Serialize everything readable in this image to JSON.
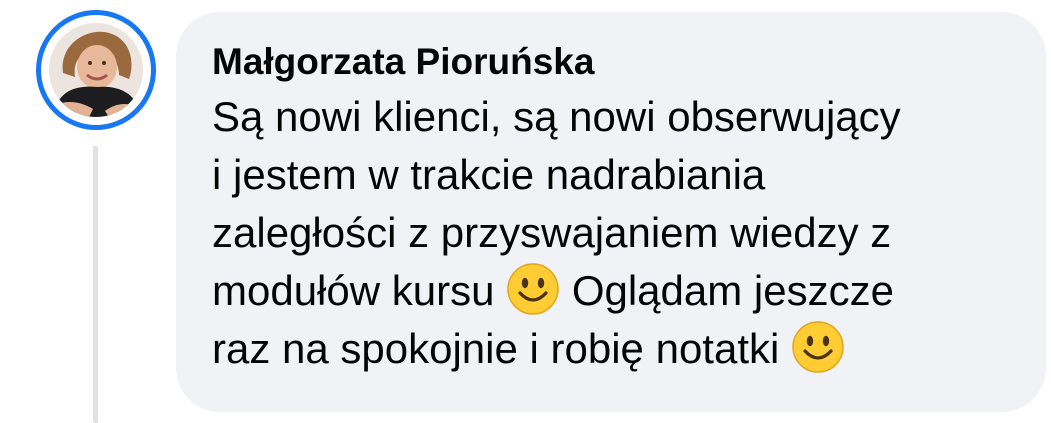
{
  "comment": {
    "author": "Małgorzata Pioruńska",
    "avatar_icon": "profile-photo",
    "lines": [
      "Są nowi klienci, są nowi obserwujący",
      "i jestem w trakcie nadrabiania",
      "zaległości z przyswajaniem wiedzy z",
      "modułów kursu",
      "Oglądam jeszcze",
      "raz na spokojnie i robię notatki"
    ],
    "emoji_icon": "slightly-smiling-face-emoji"
  },
  "colors": {
    "bubble_background": "#f0f2f5",
    "avatar_ring": "#1877f2",
    "thread_line": "#dfe1e5",
    "text": "#050505",
    "emoji_face": "#ffcc33"
  }
}
